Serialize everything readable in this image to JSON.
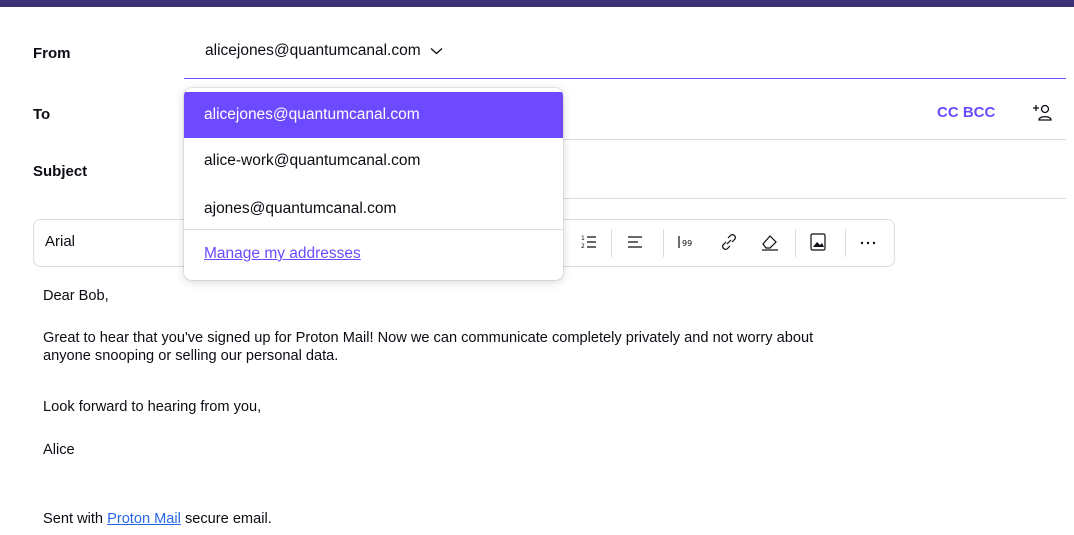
{
  "compose": {
    "from_label": "From",
    "from_value": "alicejones@quantumcanal.com",
    "to_label": "To",
    "subject_label": "Subject",
    "cc_bcc_label": "CC BCC"
  },
  "address_dropdown": {
    "options": [
      "alicejones@quantumcanal.com",
      "alice-work@quantumcanal.com",
      "ajones@quantumcanal.com"
    ],
    "selected_index": 0,
    "manage_link": "Manage my addresses"
  },
  "toolbar": {
    "font": "Arial",
    "icons": [
      "ordered-list-icon",
      "align-left-icon",
      "quote-icon",
      "link-icon",
      "clear-formatting-icon",
      "insert-image-icon",
      "more-options-icon"
    ]
  },
  "message": {
    "greeting": "Dear Bob,",
    "paragraph1_line1": "Great to hear that you've signed up for Proton Mail! Now we can communicate completely privately and not worry about",
    "paragraph1_line2": "anyone snooping or selling our personal data.",
    "paragraph2": "Look forward to hearing from you,",
    "signoff": "Alice",
    "signature_prefix": "Sent with ",
    "signature_link": "Proton Mail",
    "signature_suffix": " secure email."
  },
  "colors": {
    "accent": "#6d4aff",
    "header_bar": "#3c3377",
    "link": "#2866e6"
  }
}
